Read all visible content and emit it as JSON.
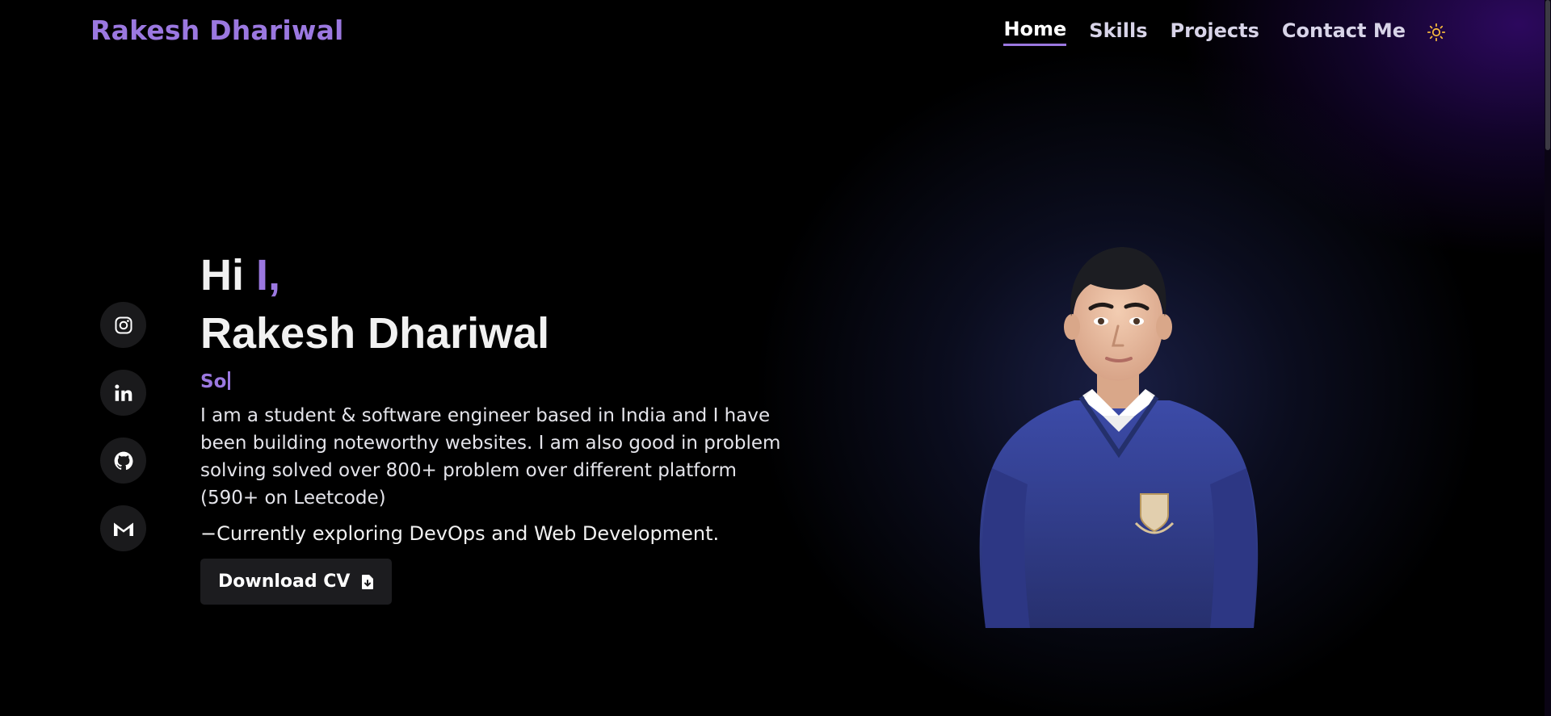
{
  "header": {
    "brand": "Rakesh Dhariwal",
    "nav": [
      {
        "label": "Home",
        "active": true
      },
      {
        "label": "Skills",
        "active": false
      },
      {
        "label": "Projects",
        "active": false
      },
      {
        "label": "Contact Me",
        "active": false
      }
    ],
    "theme_toggle_icon": "sun-icon"
  },
  "socials": [
    {
      "name": "instagram",
      "icon": "instagram-icon"
    },
    {
      "name": "linkedin",
      "icon": "linkedin-icon"
    },
    {
      "name": "github",
      "icon": "github-icon"
    },
    {
      "name": "gmail",
      "icon": "gmail-icon"
    }
  ],
  "hero": {
    "greeting": "Hi",
    "greeting_typed": "I,",
    "name": "Rakesh Dhariwal",
    "typing_text": "So",
    "bio": "I am a student & software engineer based in India and I have been building noteworthy websites. I am also good in problem solving solved over 800+ problem over different platform (590+ on Leetcode)",
    "exploring": "−Currently exploring DevOps and Web Development.",
    "cv_button": "Download CV",
    "cv_icon": "file-download-icon"
  },
  "colors": {
    "accent": "#9b78e0",
    "background": "#000000",
    "button_bg": "#1c1c1f"
  }
}
